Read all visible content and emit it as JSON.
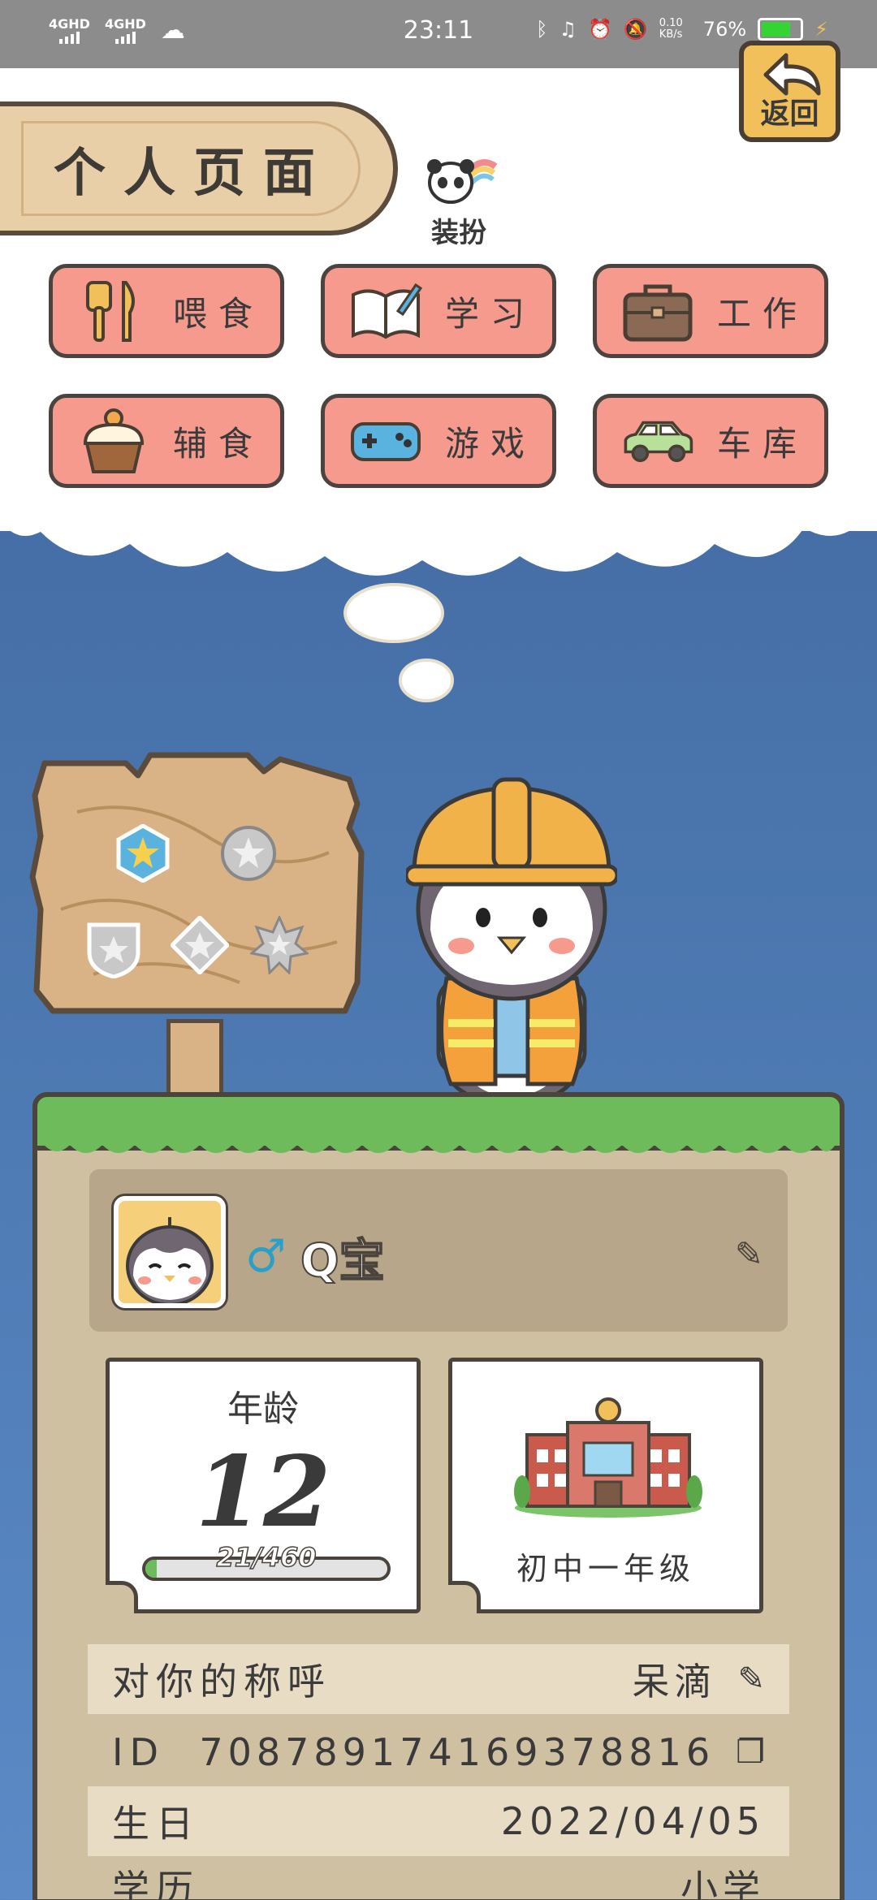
{
  "status_bar": {
    "network_1": "4GHD",
    "network_2": "4GHD",
    "time": "23:11",
    "speed": "0.10 KB/s",
    "battery": "76%",
    "battery_level": 0.76
  },
  "header": {
    "title": "个人页面",
    "dress_label": "装扮",
    "back_label": "返回"
  },
  "actions": [
    {
      "label": "喂食",
      "icon": "fork-knife-icon"
    },
    {
      "label": "学习",
      "icon": "book-pen-icon"
    },
    {
      "label": "工作",
      "icon": "briefcase-icon"
    },
    {
      "label": "辅食",
      "icon": "cupcake-icon"
    },
    {
      "label": "游戏",
      "icon": "gamepad-icon"
    },
    {
      "label": "车库",
      "icon": "car-icon"
    }
  ],
  "profile": {
    "name": "Q宝",
    "gender_icon": "male-icon",
    "age_label": "年龄",
    "age": "12",
    "progress_text": "21/460",
    "progress_fraction": 0.0457,
    "grade": "初中一年级",
    "rows": [
      {
        "key": "对你的称呼",
        "value": "呆滴",
        "icon": "edit-icon"
      },
      {
        "key": "ID",
        "value": "708789174169378816",
        "icon": "copy-icon"
      },
      {
        "key": "生日",
        "value": "2022/04/05"
      },
      {
        "key": "学历",
        "value": "小学"
      }
    ]
  },
  "colors": {
    "action_bg": "#f59a8c",
    "grass": "#6dbb5a",
    "sky_top": "#3f639c",
    "plank": "#e9cfa8"
  }
}
